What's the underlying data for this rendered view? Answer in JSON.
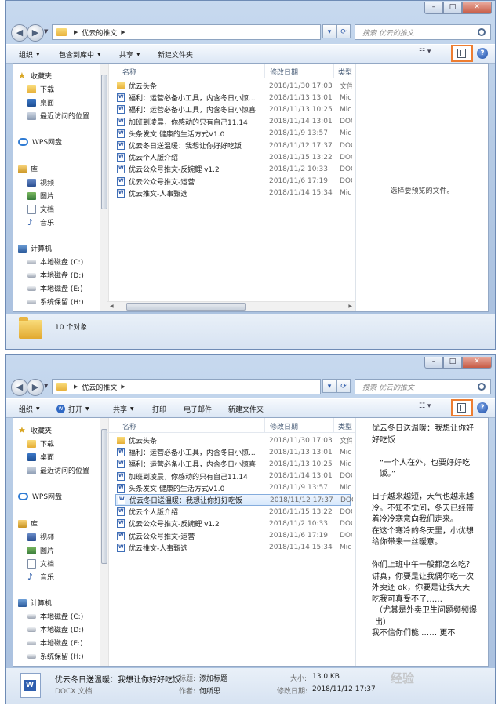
{
  "address": {
    "path": "优云的推文",
    "search_placeholder": "搜索 优云的推文"
  },
  "toolbar1": {
    "organize": "组织",
    "include": "包含到库中",
    "share": "共享",
    "new_folder": "新建文件夹"
  },
  "toolbar2": {
    "organize": "组织",
    "open": "打开",
    "share": "共享",
    "print": "打印",
    "email": "电子邮件",
    "new_folder": "新建文件夹"
  },
  "columns": {
    "name": "名称",
    "date": "修改日期",
    "type": "类型"
  },
  "nav": {
    "favorites": "收藏夹",
    "downloads": "下载",
    "desktop": "桌面",
    "recent": "最近访问的位置",
    "wps": "WPS网盘",
    "libraries": "库",
    "videos": "视频",
    "pictures": "图片",
    "documents": "文档",
    "music": "音乐",
    "computer": "计算机",
    "drive_c": "本地磁盘 (C:)",
    "drive_d": "本地磁盘 (D:)",
    "drive_e": "本地磁盘 (E:)",
    "drive_h": "系统保留 (H:)"
  },
  "files1": [
    {
      "name": "优云头条",
      "date": "2018/11/30 17:03",
      "type": "文件",
      "icon": "folder-icon"
    },
    {
      "name": "福利：运营必备小工具，内含冬日小惊...",
      "date": "2018/11/13 13:01",
      "type": "Micr",
      "icon": "word-doc-icon"
    },
    {
      "name": "福利：运营必备小工具，内含冬日小惊喜",
      "date": "2018/11/13 10:25",
      "type": "Micr",
      "icon": "word-doc-icon"
    },
    {
      "name": "加班到凌晨，你感动的只有自己11.14",
      "date": "2018/11/14 13:01",
      "type": "DOC",
      "icon": "word-doc-icon"
    },
    {
      "name": "头条发文 健康的生活方式V1.0",
      "date": "2018/11/9 13:57",
      "type": "Micr",
      "icon": "word-doc-icon"
    },
    {
      "name": "优云冬日送温暖：我想让你好好吃饭",
      "date": "2018/11/12 17:37",
      "type": "DOC",
      "icon": "word-doc-icon"
    },
    {
      "name": "优云个人版介绍",
      "date": "2018/11/15 13:22",
      "type": "DOC",
      "icon": "word-doc-icon"
    },
    {
      "name": "优云公众号推文-反婉鲤 v1.2",
      "date": "2018/11/2 10:33",
      "type": "DOC",
      "icon": "word-doc-icon"
    },
    {
      "name": "优云公众号推文-运营",
      "date": "2018/11/6 17:19",
      "type": "DOC",
      "icon": "word-doc-icon"
    },
    {
      "name": "优云推文-人事甄选",
      "date": "2018/11/14 15:34",
      "type": "Micr",
      "icon": "word-doc-icon"
    }
  ],
  "files2": [
    {
      "name": "优云头条",
      "date": "2018/11/30 17:03",
      "type": "文件",
      "icon": "folder-icon"
    },
    {
      "name": "福利：运营必备小工具，内含冬日小惊...",
      "date": "2018/11/13 13:01",
      "type": "Micr",
      "icon": "word-doc-icon"
    },
    {
      "name": "福利：运营必备小工具，内含冬日小惊喜",
      "date": "2018/11/13 10:25",
      "type": "Micr",
      "icon": "word-doc-icon"
    },
    {
      "name": "加班到凌晨，你感动的只有自己11.14",
      "date": "2018/11/14 13:01",
      "type": "DOC",
      "icon": "word-doc-icon"
    },
    {
      "name": "头条发文 健康的生活方式V1.0",
      "date": "2018/11/9 13:57",
      "type": "Micr",
      "icon": "word-doc-icon"
    },
    {
      "name": "优云冬日送温暖：我想让你好好吃饭",
      "date": "2018/11/12 17:37",
      "type": "DOC",
      "icon": "word-doc-icon",
      "selected": true
    },
    {
      "name": "优云个人版介绍",
      "date": "2018/11/15 13:22",
      "type": "DOC",
      "icon": "word-doc-icon"
    },
    {
      "name": "优云公众号推文-反婉鲤 v1.2",
      "date": "2018/11/2 10:33",
      "type": "DOC",
      "icon": "word-doc-icon"
    },
    {
      "name": "优云公众号推文-运营",
      "date": "2018/11/6 17:19",
      "type": "DOC",
      "icon": "word-doc-icon"
    },
    {
      "name": "优云推文-人事甄选",
      "date": "2018/11/14 15:34",
      "type": "Micr",
      "icon": "word-doc-icon"
    }
  ],
  "preview_empty": "选择要预览的文件。",
  "preview_doc": {
    "title": "优云冬日送温暖：我想让你好好吃饭",
    "quote": "“一个人在外，也要好好吃饭。”",
    "para1": "日子越来越短，天气也越来越冷。不知不觉间，冬天已经带着冷冷寒意向我们走来。",
    "para2": "在这个寒冷的冬天里，小优想给你带来一丝暖意。",
    "para3": "你们上班中午一般都怎么吃？",
    "para4": "讲真，你要是让我偶尔吃一次外卖还 ok，你要是让我天天吃我可真受不了……",
    "para5": "（尤其是外卖卫生问题频频爆出）",
    "para6": "我不信你们能 …… 更不"
  },
  "status1": {
    "count": "10 个对象"
  },
  "status2": {
    "filename": "优云冬日送温暖：我想让你好好吃饭",
    "filetype": "DOCX 文档",
    "title_label": "标题:",
    "title_value": "添加标题",
    "author_label": "作者:",
    "author_value": "何所思",
    "size_label": "大小:",
    "size_value": "13.0 KB",
    "modified_label": "修改日期:",
    "modified_value": "2018/11/12 17:37"
  },
  "watermark": "经验",
  "colors": {
    "accent_highlight": "#ed7d31",
    "selection": "#d6e8fb",
    "chrome": "#b6cbe5"
  }
}
